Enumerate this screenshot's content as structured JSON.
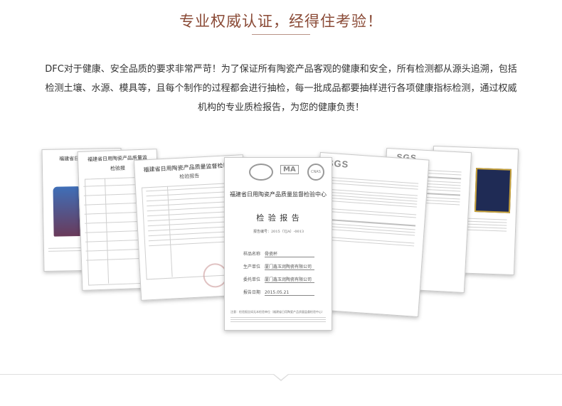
{
  "header": {
    "title": "专业权威认证，经得住考验！"
  },
  "intro": {
    "text": "DFC对于健康、安全品质的要求非常严苛！为了保证所有陶瓷产品客观的健康和安全，所有检测都从源头追溯，包括检测土壤、水源、模具等，且每个制作的过程都会进行抽检，每一批成品都要抽样进行各项健康指标检测，通过权威机构的专业质检报告，为您的健康负责！"
  },
  "documents": {
    "doc1_header": "福建省日用陶瓷产品",
    "doc2_header": "福建省日用陶瓷产品质量监",
    "doc2_sub": "检验报",
    "doc3_header": "福建省日用陶瓷产品质量监督检验中",
    "doc3_sub": "检验报告",
    "main_header": "福建省日用陶瓷产品质量监督检验中心",
    "main_title": "检  验  报  告",
    "main_number": "报告编号：2015（TJA）-0013",
    "main_fields": [
      {
        "label": "样品名称",
        "value": "骨瓷杯"
      },
      {
        "label": "生产单位",
        "value": "厦门鑫玉润陶瓷有限公司"
      },
      {
        "label": "委托单位",
        "value": "厦门鑫玉润陶瓷有限公司"
      },
      {
        "label": "报告日期",
        "value": "2015.05.21"
      }
    ],
    "main_footer_notice": "注意：检验报告如无本检验单位（福建省日用陶瓷产品质量监督检验中心）",
    "sgs_label_1": "SGS",
    "sgs_label_2": "SGS",
    "logo_ma": "MA",
    "logo_cnas": "CNAS"
  }
}
